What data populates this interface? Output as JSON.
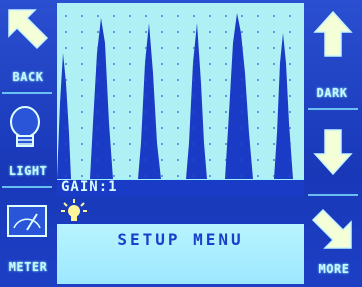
{
  "left_buttons": [
    {
      "label": "BACK",
      "icon": "arrow-up-left-icon"
    },
    {
      "label": "LIGHT",
      "icon": "lightbulb-icon"
    },
    {
      "label": "METER",
      "icon": "meter-icon"
    }
  ],
  "right_buttons": [
    {
      "label": "",
      "icon": "arrow-up-icon"
    },
    {
      "label": "DARK",
      "icon": ""
    },
    {
      "label": "",
      "icon": "arrow-down-icon"
    },
    {
      "label": "MORE",
      "icon": "arrow-down-right-icon"
    }
  ],
  "status": {
    "gain": "GAIN:1"
  },
  "menu": {
    "setup": "SETUP MENU"
  },
  "colors": {
    "background": "#1b3fc0",
    "accent": "#bff6ff",
    "text": "#1940c8"
  }
}
